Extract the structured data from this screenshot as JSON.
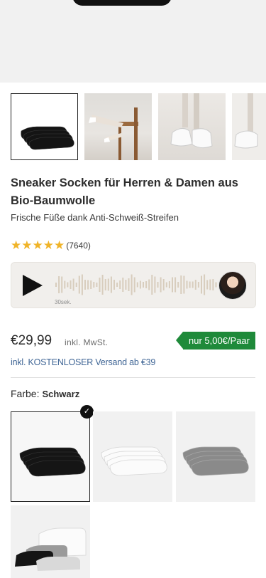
{
  "product": {
    "title": "Sneaker Socken für Herren & Damen aus Bio-Baumwolle",
    "subtitle": "Frische Füße dank Anti-Schweiß-Streifen",
    "stars": "★★★★★",
    "rating_value": 4.5,
    "rating_count": "(7640)"
  },
  "audio": {
    "duration": "30sek."
  },
  "pricing": {
    "price": "€29,99",
    "tax_note": "inkl. MwSt.",
    "per_pair_badge": "nur 5,00€/Paar",
    "shipping": "inkl. KOSTENLOSER Versand ab €39"
  },
  "color": {
    "label": "Farbe:",
    "selected": "Schwarz",
    "options": [
      "Schwarz",
      "Weiß",
      "Grau",
      "Mix"
    ]
  },
  "colors": {
    "badge_green": "#1f8a3a",
    "shipping_blue": "#3f6595",
    "star_gold": "#f0b429"
  },
  "icons": [
    "play-icon",
    "star-icon",
    "check-icon"
  ]
}
